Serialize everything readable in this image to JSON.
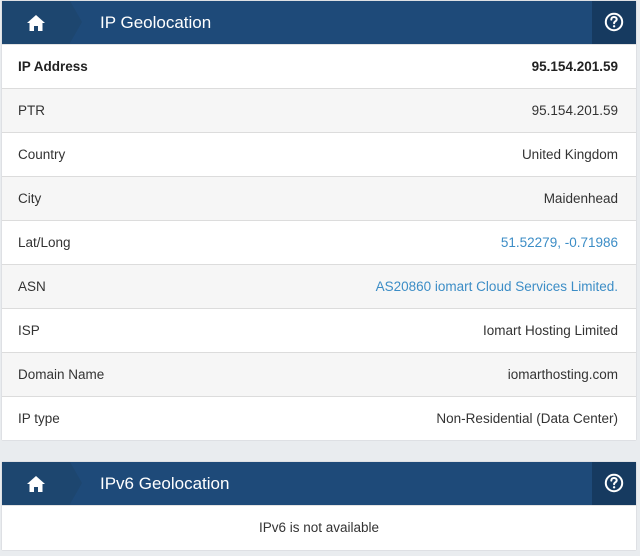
{
  "ip_panel": {
    "title": "IP Geolocation",
    "home_icon": "home-icon",
    "help_icon": "question-circle-icon",
    "rows": [
      {
        "label": "IP Address",
        "value": "95.154.201.59"
      },
      {
        "label": "PTR",
        "value": "95.154.201.59"
      },
      {
        "label": "Country",
        "value": "United Kingdom"
      },
      {
        "label": "City",
        "value": "Maidenhead"
      },
      {
        "label": "Lat/Long",
        "value": "51.52279, -0.71986"
      },
      {
        "label": "ASN",
        "value": "AS20860 iomart Cloud Services Limited."
      },
      {
        "label": "ISP",
        "value": "Iomart Hosting Limited"
      },
      {
        "label": "Domain Name",
        "value": "iomarthosting.com"
      },
      {
        "label": "IP type",
        "value": "Non-Residential (Data Center)"
      }
    ]
  },
  "ipv6_panel": {
    "title": "IPv6 Geolocation",
    "home_icon": "home-icon",
    "help_icon": "question-circle-icon",
    "message": "IPv6 is not available"
  },
  "colors": {
    "header_bg": "#1e4a79",
    "link": "#3c8dc6",
    "page_bg": "#e9ecef"
  }
}
